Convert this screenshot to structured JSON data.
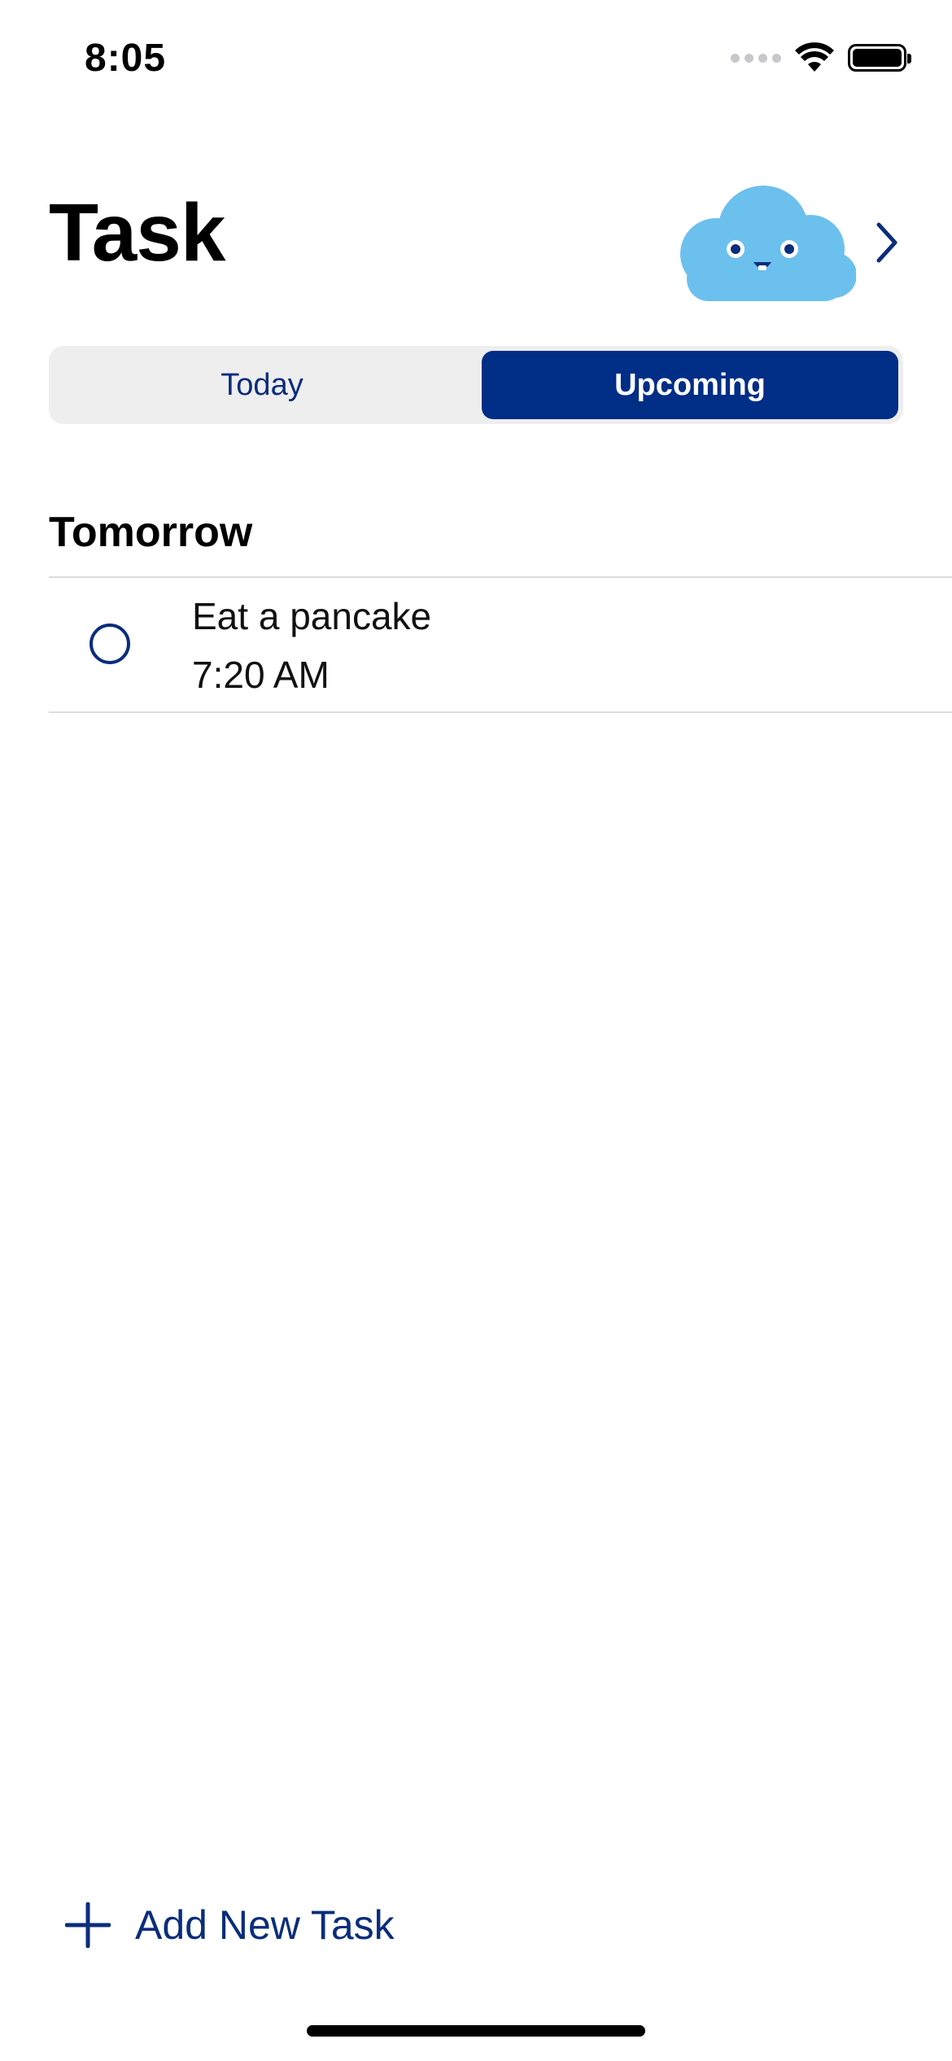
{
  "status_bar": {
    "time": "8:05",
    "icons": [
      "signal-icon",
      "wifi-icon",
      "battery-icon"
    ]
  },
  "header": {
    "title": "Task",
    "mascot_icon": "cloud-mascot-icon",
    "chevron_icon": "chevron-right-icon"
  },
  "tabs": [
    {
      "label": "Today",
      "selected": false
    },
    {
      "label": "Upcoming",
      "selected": true
    }
  ],
  "sections": [
    {
      "header": "Tomorrow",
      "tasks": [
        {
          "title": "Eat a pancake",
          "time": "7:20 AM",
          "completed": false
        }
      ]
    }
  ],
  "add_task": {
    "label": "Add New Task",
    "icon": "plus-icon"
  },
  "colors": {
    "accent": "#002D86",
    "accent_text": "#0A2D7C",
    "segment_background": "#EEEEEF",
    "mascot_cloud": "#6CC0EE",
    "divider": "#DCDCDF"
  }
}
